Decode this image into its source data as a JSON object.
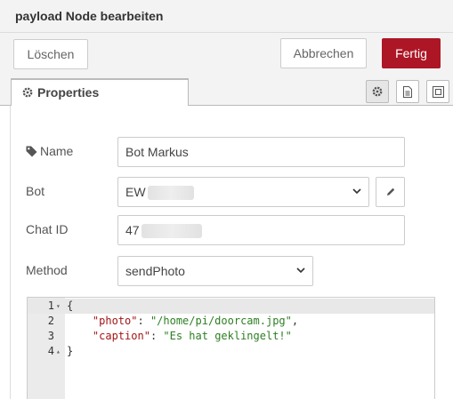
{
  "dialog": {
    "title": "payload Node bearbeiten"
  },
  "actions": {
    "delete_label": "Löschen",
    "cancel_label": "Abbrechen",
    "done_label": "Fertig"
  },
  "tabs": [
    {
      "label": "Properties",
      "icon": "gear-icon"
    }
  ],
  "toolbar_icons": [
    "gear-icon",
    "document-icon",
    "frame-icon"
  ],
  "form": {
    "name": {
      "label": "Name",
      "icon": "tag-icon",
      "value": "Bot Markus"
    },
    "bot": {
      "label": "Bot",
      "value": "EW"
    },
    "chat_id": {
      "label": "Chat ID",
      "value": "47"
    },
    "method": {
      "label": "Method",
      "value": "sendPhoto"
    }
  },
  "editor": {
    "lines": [
      {
        "num": "1",
        "fold": "▾",
        "text": "{"
      },
      {
        "num": "2",
        "fold": "",
        "key": "\"photo\"",
        "sep": ": ",
        "val": "\"/home/pi/doorcam.jpg\"",
        "tail": ","
      },
      {
        "num": "3",
        "fold": "",
        "key": "\"caption\"",
        "sep": ": ",
        "val": "\"Es hat geklingelt!\"",
        "tail": ""
      },
      {
        "num": "4",
        "fold": "▴",
        "text": "}"
      }
    ]
  },
  "colors": {
    "primary": "#ad1625",
    "json_key": "#a31515",
    "json_string": "#2d7e22"
  }
}
